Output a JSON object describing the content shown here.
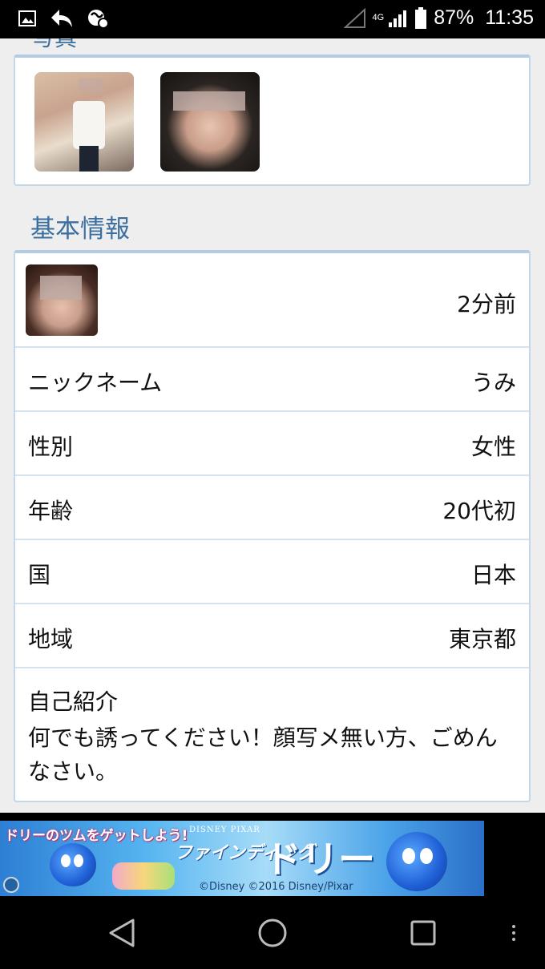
{
  "status_bar": {
    "network": "4G",
    "battery": "87%",
    "time": "11:35"
  },
  "photos_section": {
    "title": "写真"
  },
  "basic_info": {
    "title": "基本情報",
    "last_login": "2分前",
    "rows": [
      {
        "label": "ニックネーム",
        "value": "うみ"
      },
      {
        "label": "性別",
        "value": "女性"
      },
      {
        "label": "年齢",
        "value": "20代初"
      },
      {
        "label": "国",
        "value": "日本"
      },
      {
        "label": "地域",
        "value": "東京都"
      }
    ],
    "bio_label": "自己紹介",
    "bio_text": "何でも誘ってください！顔写メ無い方、ごめんなさい。"
  },
  "banner": {
    "tagline": "ドリーのツムをゲットしよう!",
    "brand": "DISNEY PIXAR",
    "finding": "ファインディング",
    "dory": "ドリー",
    "copyright": "©Disney ©2016 Disney/Pixar"
  },
  "colors": {
    "accent": "#3b6fa0",
    "card_border": "#c3d6ea",
    "background": "#eeeeee"
  }
}
